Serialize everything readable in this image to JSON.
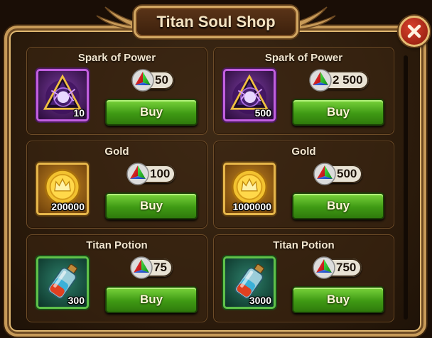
{
  "title": "Titan Soul Shop",
  "colors": {
    "frame_gold": "#c79a58",
    "buy_green": "#3f9a14",
    "rarity_purple": "#c25fe0",
    "rarity_gold": "#e6b64a",
    "rarity_green": "#5fc24a"
  },
  "currency_icon": "titan-soul-gem-icon",
  "items": [
    {
      "name": "Spark of Power",
      "quantity": "10",
      "price": "50",
      "buy_label": "Buy",
      "icon": "spark-of-power-icon",
      "rarity": "purple"
    },
    {
      "name": "Spark of Power",
      "quantity": "500",
      "price": "2 500",
      "buy_label": "Buy",
      "icon": "spark-of-power-icon",
      "rarity": "purple"
    },
    {
      "name": "Gold",
      "quantity": "200000",
      "price": "100",
      "buy_label": "Buy",
      "icon": "gold-coin-icon",
      "rarity": "gold"
    },
    {
      "name": "Gold",
      "quantity": "1000000",
      "price": "500",
      "buy_label": "Buy",
      "icon": "gold-coin-icon",
      "rarity": "gold"
    },
    {
      "name": "Titan Potion",
      "quantity": "300",
      "price": "75",
      "buy_label": "Buy",
      "icon": "titan-potion-icon",
      "rarity": "green"
    },
    {
      "name": "Titan Potion",
      "quantity": "3000",
      "price": "750",
      "buy_label": "Buy",
      "icon": "titan-potion-icon",
      "rarity": "green"
    }
  ]
}
